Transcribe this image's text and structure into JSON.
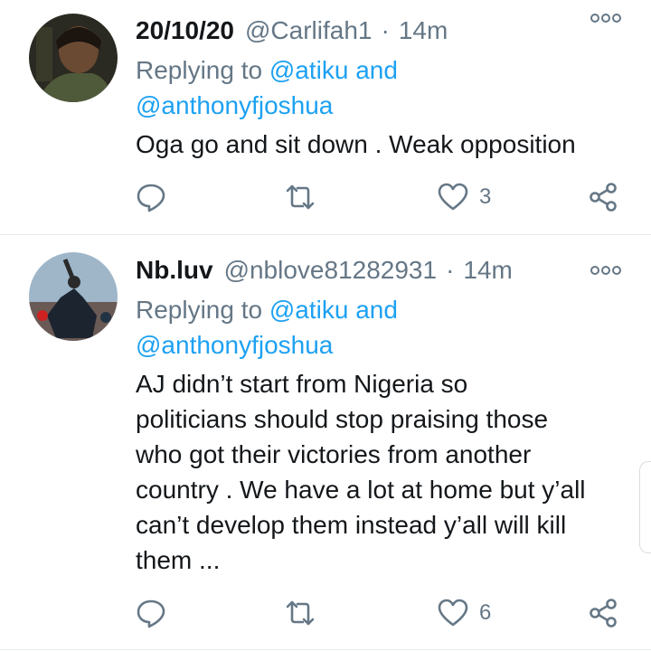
{
  "tweets": [
    {
      "name": "20/10/20",
      "handle": "@Carlifah1",
      "separator": "·",
      "time": "14m",
      "replying_prefix": "Replying to",
      "replying_mention1": "@atiku",
      "replying_and": "and",
      "replying_mention2": "@anthonyfjoshua",
      "text_lines": [
        "Oga go and sit down . Weak opposition"
      ],
      "reply_count": "",
      "retweet_count": "",
      "like_count": "3",
      "icons": {
        "more": "more-icon",
        "reply": "reply-icon",
        "retweet": "retweet-icon",
        "like": "heart-icon",
        "share": "share-icon"
      }
    },
    {
      "name": "Nb.luv",
      "handle": "@nblove81282931",
      "separator": "·",
      "time": "14m",
      "replying_prefix": "Replying to",
      "replying_mention1": "@atiku",
      "replying_and": "and",
      "replying_mention2": "@anthonyfjoshua",
      "text_lines": [
        "AJ didn’t start from Nigeria so",
        "politicians should stop praising those",
        "who got their victories from another",
        "country . We have a lot at home but y’all",
        "can’t develop them instead y’all will kill",
        "them ..."
      ],
      "reply_count": "",
      "retweet_count": "",
      "like_count": "6",
      "icons": {
        "more": "more-icon",
        "reply": "reply-icon",
        "retweet": "retweet-icon",
        "like": "heart-icon",
        "share": "share-icon"
      }
    }
  ],
  "colors": {
    "text": "#14171a",
    "secondary": "#657786",
    "link": "#1da1f2",
    "divider": "#e6ecf0"
  }
}
